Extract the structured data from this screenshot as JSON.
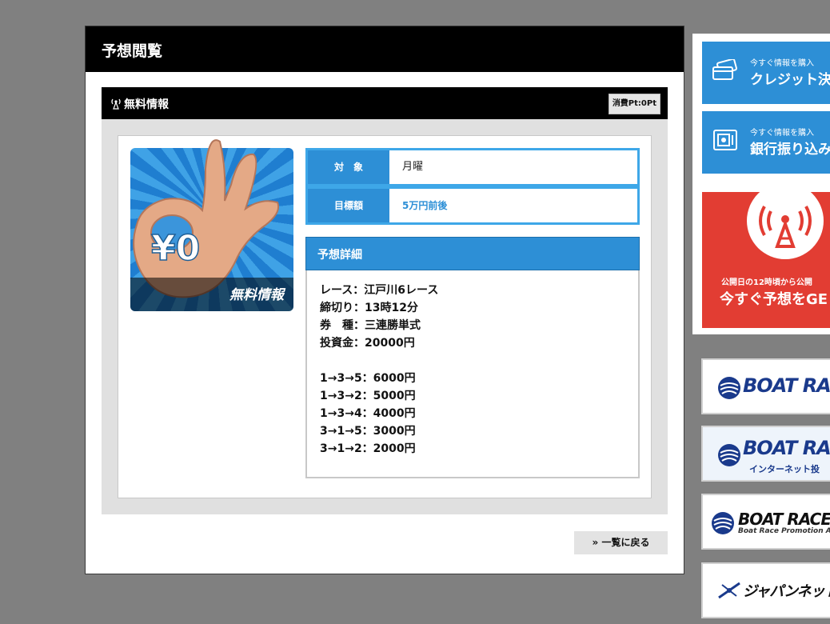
{
  "main": {
    "title": "予想閲覧",
    "section_title": "無料情報",
    "points_badge": "消費Pt:0Pt",
    "free_image_caption": "無料情報",
    "free_image_text": "¥0",
    "info_rows": [
      {
        "label": "対　象",
        "value": "月曜"
      },
      {
        "label": "目標額",
        "value": "5万円前後"
      }
    ],
    "detail_title": "予想詳細",
    "detail_lines": [
      "レース：江戸川6レース",
      "締切り：13時12分",
      "券　種：三連勝単式",
      "投資金：20000円"
    ],
    "bet_lines": [
      "1→3→5：6000円",
      "1→3→2：5000円",
      "1→3→4：4000円",
      "3→1→5：3000円",
      "3→1→2：2000円"
    ],
    "back_label": "» 一覧に戻る"
  },
  "side": {
    "credit": {
      "small": "今すぐ情報を購入",
      "big": "クレジット決"
    },
    "bank": {
      "small": "今すぐ情報を購入",
      "big": "銀行振り込み"
    },
    "get": {
      "small": "公開日の12時頃から公開",
      "big": "今すぐ予想をGE"
    },
    "banners": [
      {
        "text": "BOAT RACE",
        "sub": ""
      },
      {
        "text": "BOAT RACE",
        "sub": "インターネット投"
      },
      {
        "text": "BOAT RACE振",
        "sub": "Boat Race Promotion Asso"
      },
      {
        "text": "ジャパンネット銀",
        "sub": ""
      }
    ]
  },
  "colors": {
    "accent": "#2d8fd6",
    "border_blue": "#3ea7e8",
    "red": "#e23d33"
  }
}
